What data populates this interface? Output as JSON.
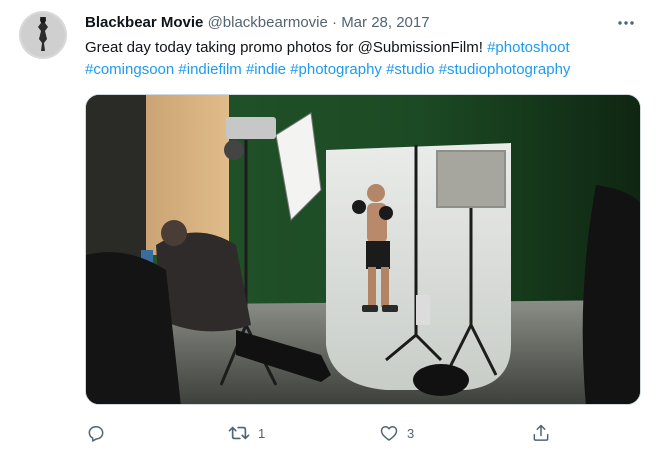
{
  "tweet": {
    "author": {
      "display_name": "Blackbear Movie",
      "handle": "@blackbearmovie",
      "separator": "·",
      "timestamp": "Mar 28, 2017",
      "avatar_icon": "bear-logo-icon"
    },
    "text": {
      "line1_plain": "Great day today taking promo photos for @SubmissionFilm! ",
      "line1_tags": [
        "#photoshoot"
      ],
      "line2_tags": [
        "#comingsoon",
        "#indiefilm",
        "#indie",
        "#photography",
        "#studio",
        "#studiophotography"
      ]
    },
    "media": {
      "description_icon": "photo-studio-image"
    },
    "actions": {
      "reply": {
        "icon": "reply-icon",
        "count": ""
      },
      "retweet": {
        "icon": "retweet-icon",
        "count": "1"
      },
      "like": {
        "icon": "heart-icon",
        "count": "3"
      },
      "share": {
        "icon": "share-icon",
        "count": ""
      }
    },
    "more_icon": "more-dots-icon"
  },
  "colors": {
    "link": "#1d9bf0",
    "secondary_text": "#536471",
    "primary_text": "#0f1419",
    "green_screen": "#1f5a2a"
  }
}
